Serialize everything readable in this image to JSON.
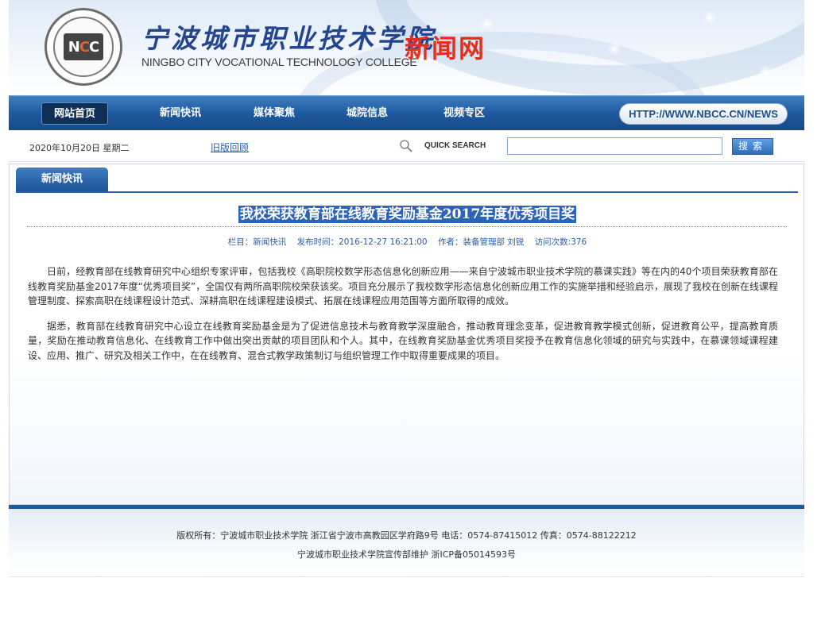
{
  "header": {
    "college_name": "宁波城市职业技术学院",
    "college_name_en": "NINGBO CITY VOCATIONAL TECHNOLOGY COLLEGE",
    "site_name": "新闻网",
    "logo_icon": "college-seal-logo"
  },
  "nav": {
    "items": [
      {
        "label": "网站首页",
        "active": true
      },
      {
        "label": "新闻快讯",
        "active": false
      },
      {
        "label": "媒体聚焦",
        "active": false
      },
      {
        "label": "城院信息",
        "active": false
      },
      {
        "label": "视频专区",
        "active": false
      }
    ],
    "site_url": "HTTP://WWW.NBCC.CN/NEWS"
  },
  "subbar": {
    "date": "2020年10月20日  星期二",
    "old_version_link": "旧版回顾",
    "quick_search_label": "QUICK SEARCH",
    "search_value": "",
    "search_button": "搜索"
  },
  "section": {
    "tab_label": "新闻快讯"
  },
  "article": {
    "title": "我校荣获教育部在线教育奖励基金2017年度优秀项目奖",
    "meta": {
      "column": "栏目：新闻快讯",
      "time": "发布时间：2016-12-27  16:21:00",
      "author": "作者：装备管理部 刘锐",
      "views": "访问次数:376"
    },
    "paragraphs": [
      "日前，经教育部在线教育研究中心组织专家评审，包括我校《高职院校数学形态信息化创新应用——来自宁波城市职业技术学院的慕课实践》等在内的40个项目荣获教育部在线教育奖励基金2017年度“优秀项目奖”，全国仅有两所高职院校荣获该奖。项目充分展示了我校数学形态信息化创新应用工作的实施举措和经验启示，展现了我校在创新在线课程管理制度、探索高职在线课程设计范式、深耕高职在线课程建设模式、拓展在线课程应用范围等方面所取得的成效。",
      "据悉，教育部在线教育研究中心设立在线教育奖励基金是为了促进信息技术与教育教学深度融合，推动教育理念变革，促进教育教学模式创新，促进教育公平，提高教育质量，奖励在推动教育信息化、在线教育工作中做出突出贡献的项目团队和个人。其中，在线教育奖励基金优秀项目奖授予在教育信息化领域的研究与实践中，在慕课领域课程建设、应用、推广、研究及相关工作中，在在线教育、混合式教学政策制订与组织管理工作中取得重要成果的项目。"
    ]
  },
  "footer": {
    "line1": "版权所有：宁波城市职业技术学院  浙江省宁波市高教园区学府路9号  电话：0574-87415012  传真：0574-88122212",
    "line2": "宁波城市职业技术学院宣传部维护  浙ICP备05014593号"
  }
}
